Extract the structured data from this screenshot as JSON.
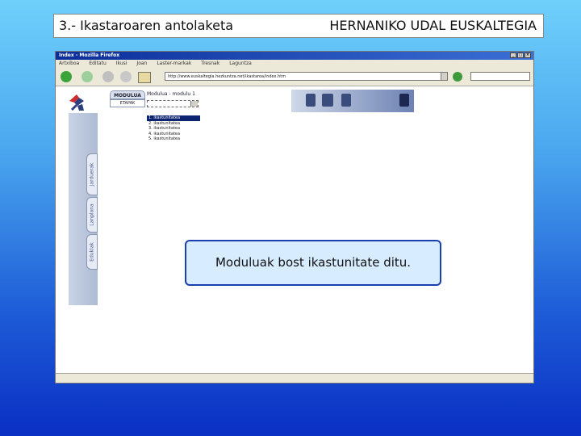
{
  "slide": {
    "title_left": "3.- Ikastaroaren antolaketa",
    "title_right": "HERNANIKO UDAL EUSKALTEGIA"
  },
  "browser": {
    "window_title": "Index - Mozilla Firefox",
    "menu": [
      "Artxiboa",
      "Editatu",
      "Ikusi",
      "Joan",
      "Laster-markak",
      "Tresnak",
      "Laguntza"
    ],
    "url": "http://www.euskaltegia.hezkuntza.net/ikastaroa/index.htm"
  },
  "page": {
    "tabs": {
      "modulua": "MODULUA",
      "etapak": "ETAPAK"
    },
    "module_label": "Modulua - modulu 1",
    "units": [
      "1. ikastunitatea",
      "2. ikastunitatea",
      "3. ikastunitatea",
      "4. ikastunitatea",
      "5. ikastunitatea"
    ],
    "side_tabs": [
      "Jarduerak",
      "Lanplana",
      "Eduklak"
    ]
  },
  "callout": {
    "text": "Moduluak bost ikastunitate ditu."
  },
  "colors": {
    "background_top": "#6fd0fb",
    "background_bottom": "#0a2fc4",
    "callout_fill": "#d7ecff",
    "callout_border": "#1a3fb0",
    "selection": "#0a2470"
  }
}
